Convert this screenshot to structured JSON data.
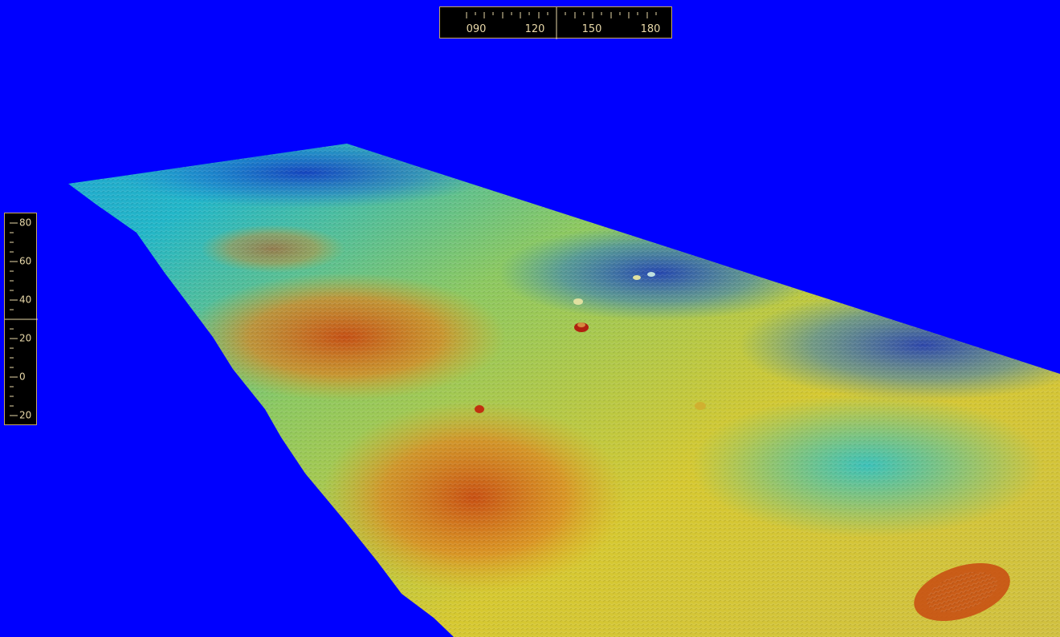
{
  "view": {
    "background_color": "#0000ff",
    "instrument_border_color": "#c8a860",
    "instrument_text_color": "#e8d8a8"
  },
  "compass": {
    "ticks": [
      "090",
      "120",
      "150",
      "180"
    ]
  },
  "depth_scale": {
    "ticks": [
      "80",
      "60",
      "40",
      "20",
      "0",
      "20"
    ]
  },
  "terrain": {
    "colormap": [
      "#1030c0",
      "#1a7fd6",
      "#1fb8c8",
      "#6ec890",
      "#d8d030",
      "#e89a20",
      "#c84a10"
    ]
  }
}
